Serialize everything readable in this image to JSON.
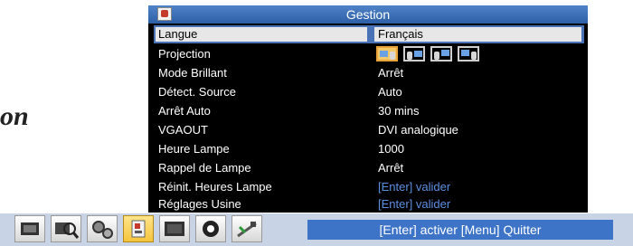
{
  "side_text": "on",
  "menu": {
    "title": "Gestion",
    "title_icon": "settings-tab-icon",
    "selected": {
      "label": "Langue",
      "value": "Français"
    },
    "projection": {
      "label": "Projection",
      "options": [
        "front-desktop-icon",
        "rear-desktop-icon",
        "front-ceiling-icon",
        "rear-ceiling-icon"
      ],
      "active_index": 0
    },
    "rows": [
      {
        "label": "Mode Brillant",
        "value": "Arrêt"
      },
      {
        "label": "Détect. Source",
        "value": "Auto"
      },
      {
        "label": "Arrêt Auto",
        "value": "30 mins"
      },
      {
        "label": "VGAOUT",
        "value": "DVI analogique"
      },
      {
        "label": "Heure Lampe",
        "value": "1000"
      },
      {
        "label": "Rappel de Lampe",
        "value": "Arrêt"
      },
      {
        "label": "Réinit. Heures Lampe",
        "value": "[Enter] valider"
      },
      {
        "label": "Réglages Usine",
        "value": "[Enter] valider"
      }
    ]
  },
  "bottom": {
    "tabs": [
      "image-tab-icon",
      "zoom-tab-icon",
      "gears-tab-icon",
      "management-tab-icon",
      "display-tab-icon",
      "audio-tab-icon",
      "satellite-tab-icon"
    ],
    "active_tab": 3,
    "status": "[Enter] activer [Menu] Quitter"
  },
  "colors": {
    "accent": "#4a72b6",
    "value_link": "#5c8fe0",
    "active_tab": "#f5c43b"
  }
}
